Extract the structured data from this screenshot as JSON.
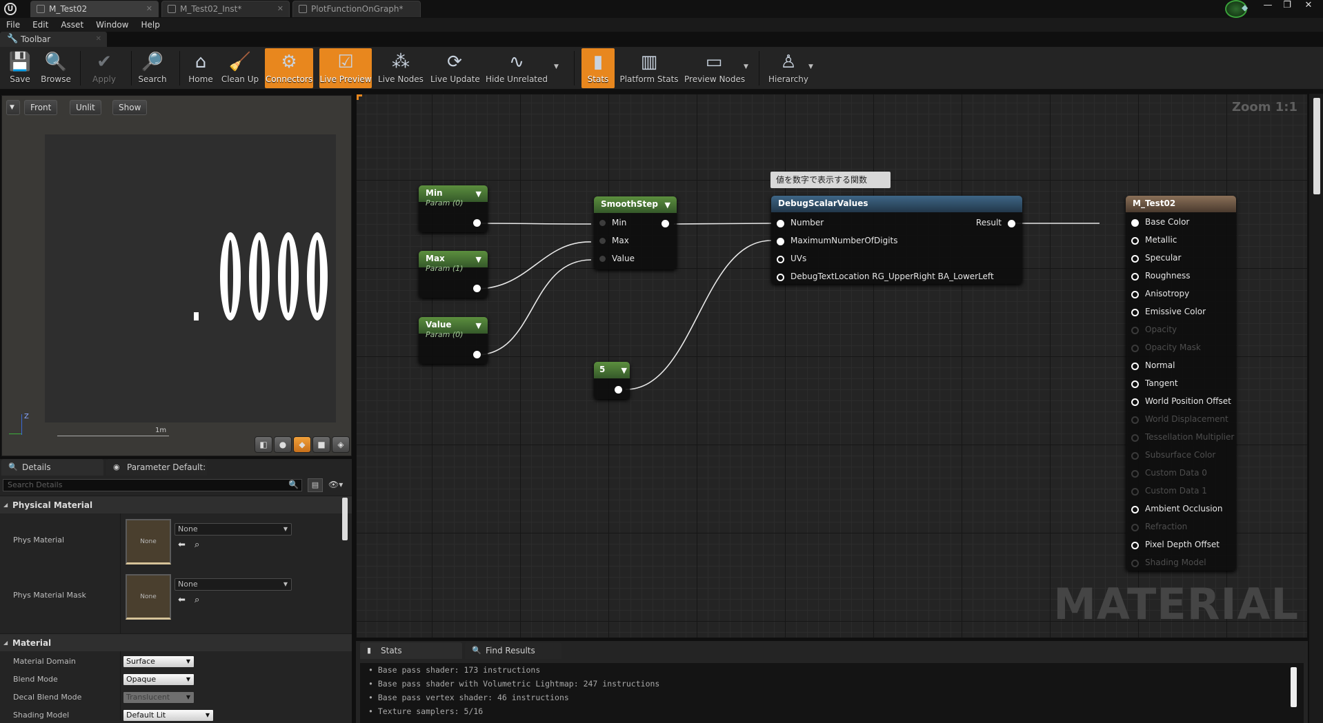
{
  "window": {
    "tabs": [
      {
        "label": "M_Test02",
        "active": true
      },
      {
        "label": "M_Test02_Inst*",
        "active": false
      },
      {
        "label": "PlotFunctionOnGraph*",
        "active": false
      }
    ]
  },
  "menu": [
    "File",
    "Edit",
    "Asset",
    "Window",
    "Help"
  ],
  "toolbar": {
    "tab_label": "Toolbar",
    "buttons": [
      {
        "label": "Save",
        "icon": "save-icon"
      },
      {
        "label": "Browse",
        "icon": "browse-icon"
      },
      {
        "label": "Apply",
        "icon": "apply-icon",
        "disabled": true
      },
      {
        "label": "Search",
        "icon": "search-icon"
      },
      {
        "label": "Home",
        "icon": "home-icon"
      },
      {
        "label": "Clean Up",
        "icon": "clean-up-icon"
      },
      {
        "label": "Connectors",
        "icon": "connectors-icon",
        "active": true
      },
      {
        "label": "Live Preview",
        "icon": "live-preview-icon",
        "active": true
      },
      {
        "label": "Live Nodes",
        "icon": "live-nodes-icon"
      },
      {
        "label": "Live Update",
        "icon": "live-update-icon"
      },
      {
        "label": "Hide Unrelated",
        "icon": "hide-unrelated-icon"
      },
      {
        "label": "Stats",
        "icon": "stats-icon",
        "active": true
      },
      {
        "label": "Platform Stats",
        "icon": "platform-stats-icon"
      },
      {
        "label": "Preview Nodes",
        "icon": "preview-nodes-icon"
      },
      {
        "label": "Hierarchy",
        "icon": "hierarchy-icon"
      }
    ]
  },
  "viewport": {
    "buttons": [
      "Front",
      "Unlit",
      "Show"
    ],
    "display_text": "0000",
    "scale_label": "1m",
    "axis_label": "Z"
  },
  "details": {
    "tabs": [
      "Details",
      "Parameter Default:"
    ],
    "search_placeholder": "Search Details",
    "sections": {
      "physical_material": {
        "title": "Physical Material",
        "rows": [
          {
            "label": "Phys Material",
            "thumb": "None",
            "value": "None"
          },
          {
            "label": "Phys Material Mask",
            "thumb": "None",
            "value": "None"
          }
        ]
      },
      "material": {
        "title": "Material",
        "rows": [
          {
            "label": "Material Domain",
            "value": "Surface"
          },
          {
            "label": "Blend Mode",
            "value": "Opaque"
          },
          {
            "label": "Decal Blend Mode",
            "value": "Translucent"
          },
          {
            "label": "Shading Model",
            "value": "Default Lit"
          }
        ]
      }
    }
  },
  "graph": {
    "zoom": "Zoom 1:1",
    "watermark": "MATERIAL",
    "comment": "値を数字で表示する関数",
    "nodes": {
      "min": {
        "title": "Min",
        "subtitle": "Param (0)"
      },
      "max": {
        "title": "Max",
        "subtitle": "Param (1)"
      },
      "value": {
        "title": "Value",
        "subtitle": "Param (0)"
      },
      "smoothstep": {
        "title": "SmoothStep",
        "inputs": [
          "Min",
          "Max",
          "Value"
        ]
      },
      "constant": {
        "title": "5"
      },
      "debug": {
        "title": "DebugScalarValues",
        "inputs": [
          "Number",
          "MaximumNumberOfDigits",
          "UVs",
          "DebugTextLocation RG_UpperRight BA_LowerLeft"
        ],
        "output": "Result"
      },
      "material": {
        "title": "M_Test02",
        "inputs": [
          {
            "label": "Base Color",
            "enabled": true,
            "connected": true
          },
          {
            "label": "Metallic",
            "enabled": true
          },
          {
            "label": "Specular",
            "enabled": true
          },
          {
            "label": "Roughness",
            "enabled": true
          },
          {
            "label": "Anisotropy",
            "enabled": true
          },
          {
            "label": "Emissive Color",
            "enabled": true
          },
          {
            "label": "Opacity",
            "enabled": false
          },
          {
            "label": "Opacity Mask",
            "enabled": false
          },
          {
            "label": "Normal",
            "enabled": true
          },
          {
            "label": "Tangent",
            "enabled": true
          },
          {
            "label": "World Position Offset",
            "enabled": true
          },
          {
            "label": "World Displacement",
            "enabled": false
          },
          {
            "label": "Tessellation Multiplier",
            "enabled": false
          },
          {
            "label": "Subsurface Color",
            "enabled": false
          },
          {
            "label": "Custom Data 0",
            "enabled": false
          },
          {
            "label": "Custom Data 1",
            "enabled": false
          },
          {
            "label": "Ambient Occlusion",
            "enabled": true
          },
          {
            "label": "Refraction",
            "enabled": false
          },
          {
            "label": "Pixel Depth Offset",
            "enabled": true
          },
          {
            "label": "Shading Model",
            "enabled": false
          }
        ]
      }
    }
  },
  "stats": {
    "tabs": [
      "Stats",
      "Find Results"
    ],
    "lines": [
      "Base pass shader: 173 instructions",
      "Base pass shader with Volumetric Lightmap: 247 instructions",
      "Base pass vertex shader: 46 instructions",
      "Texture samplers: 5/16"
    ]
  }
}
